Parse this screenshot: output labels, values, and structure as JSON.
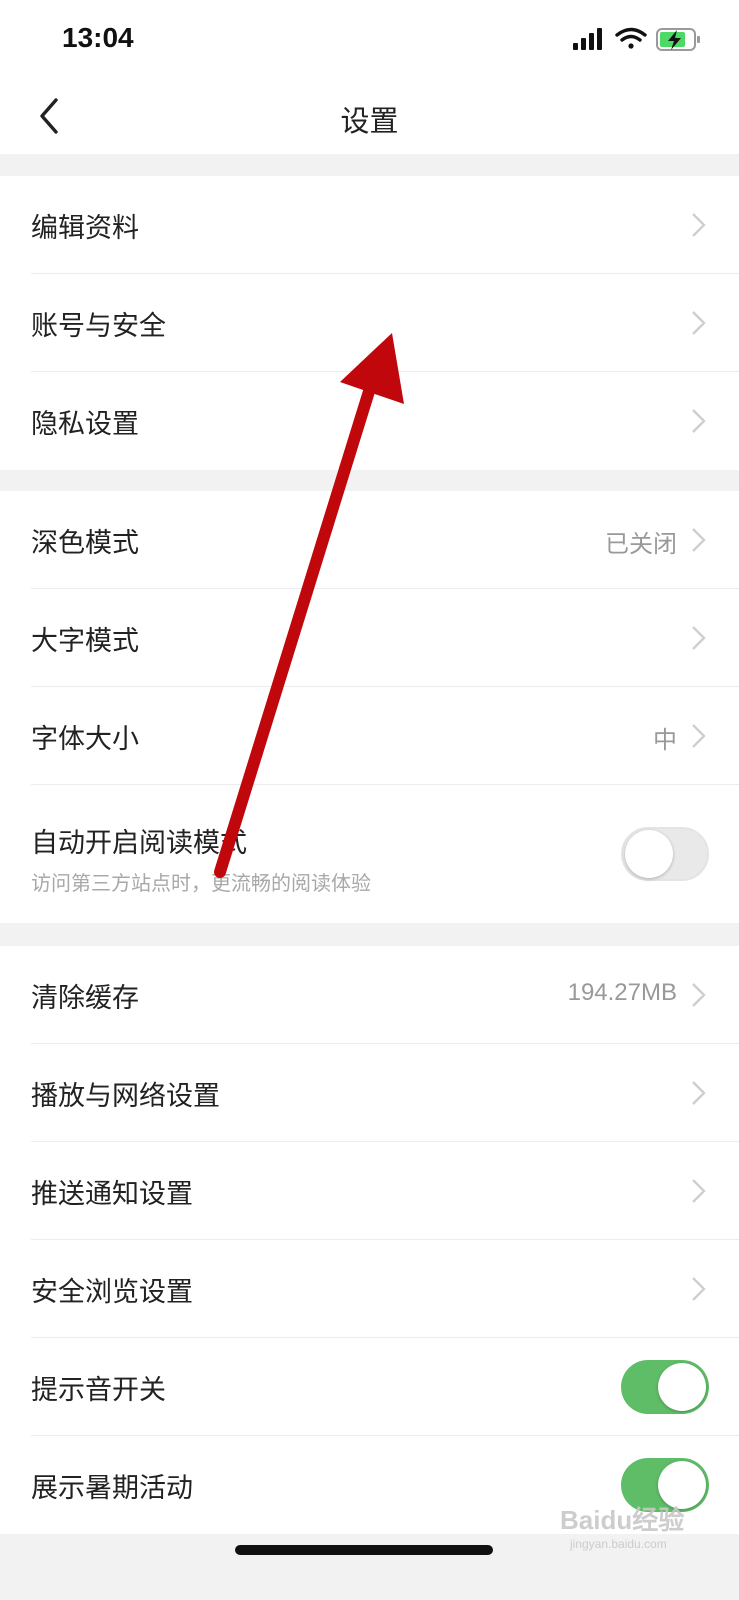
{
  "status": {
    "time": "13:04"
  },
  "nav": {
    "title": "设置",
    "back_icon": "chevron-left-icon"
  },
  "groups": [
    {
      "items": [
        {
          "label": "编辑资料",
          "value": "",
          "control": "chevron"
        },
        {
          "label": "账号与安全",
          "value": "",
          "control": "chevron"
        },
        {
          "label": "隐私设置",
          "value": "",
          "control": "chevron"
        }
      ]
    },
    {
      "items": [
        {
          "label": "深色模式",
          "value": "已关闭",
          "control": "chevron"
        },
        {
          "label": "大字模式",
          "value": "",
          "control": "chevron"
        },
        {
          "label": "字体大小",
          "value": "中",
          "control": "chevron"
        },
        {
          "label": "自动开启阅读模式",
          "sub": "访问第三方站点时，更流畅的阅读体验",
          "control": "toggle",
          "on": false
        }
      ]
    },
    {
      "items": [
        {
          "label": "清除缓存",
          "value": "194.27MB",
          "control": "chevron"
        },
        {
          "label": "播放与网络设置",
          "value": "",
          "control": "chevron"
        },
        {
          "label": "推送通知设置",
          "value": "",
          "control": "chevron"
        },
        {
          "label": "安全浏览设置",
          "value": "",
          "control": "chevron"
        },
        {
          "label": "提示音开关",
          "control": "toggle",
          "on": true
        },
        {
          "label": "展示暑期活动",
          "control": "toggle",
          "on": true
        }
      ]
    }
  ],
  "watermark": {
    "brand": "Baidu经验",
    "url": "jingyan.baidu.com"
  },
  "colors": {
    "toggle_on": "#5fbd68",
    "arrow": "#c0070b"
  }
}
